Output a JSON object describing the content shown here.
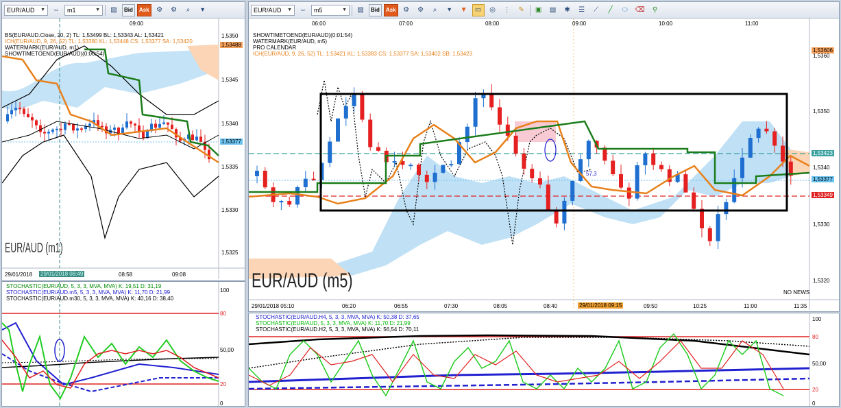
{
  "left_window": {
    "symbol": "EUR/AUD",
    "timeframe": "m1",
    "time_top": "09:00",
    "indicators": [
      {
        "text": "BS(EUR/AUD.Close, 20, 2)  TL: 1,53499  BL: 1,53343  AL: 1,53421",
        "color": "#000000"
      },
      {
        "text": "ICH(EUR/AUD, 9, 26, 52)  TL: 1,53380  KL: 1,53448  CS: 1,53377  SA: 1,53420",
        "color": "#e8801a"
      },
      {
        "text": "WATERMARK(EUR/AUD, m1)",
        "color": "#000000"
      },
      {
        "text": "SHOWTIMETOEND(EUR/AUD)(0:00:54)",
        "color": "#000000"
      }
    ],
    "watermark": "EUR/AUD (m1)",
    "price_axis": [
      "1,5350",
      "1,5345",
      "1,5340",
      "1,5335",
      "1,5330",
      "1,5325"
    ],
    "price_tags": [
      {
        "text": "1,53488",
        "bg": "#f5a05a"
      },
      {
        "text": "1,53377",
        "bg": "#6cc3f0"
      }
    ],
    "time_axis": [
      "29/01/2018",
      "08:58",
      "09:08"
    ],
    "time_badge": "29/01/2018 08:49",
    "stoch_legend": [
      {
        "text": "STOCHASTIC(EUR/AUD, 5, 3, 3, MVA, MVA)  K: 19,51  D: 31,19",
        "color": "#008800"
      },
      {
        "text": "STOCHASTIC(EUR/AUD.m5, 5, 3, 3, MVA, MVA)  K: 11,70  D: 21,99",
        "color": "#2020d0"
      },
      {
        "text": "STOCHASTIC(EUR/AUD.m30, 5, 3, 3, MVA, MVA)  K: 40,16  D: 38,40",
        "color": "#000000"
      }
    ],
    "stoch_axis": [
      "100",
      "80",
      "50,00",
      "20",
      "0"
    ]
  },
  "right_window": {
    "symbol": "EUR/AUD",
    "timeframe": "m5",
    "time_top": [
      "06:00",
      "07:00",
      "08:00",
      "09:00",
      "10:00",
      "11:00"
    ],
    "indicators": [
      {
        "text": "SHOWTIMETOEND(EUR/AUD)(0:01:54)",
        "color": "#000000"
      },
      {
        "text": "WATERMARK(EUR/AUD, m5)",
        "color": "#000000"
      },
      {
        "text": "PRO CALENDAR",
        "color": "#000000"
      },
      {
        "text": "ICH(EUR/AUD, 9, 26, 52)  TL: 1,53421  KL: 1,53383  CS: 1,53377  SA: 1,53402  SB: 1,53423",
        "color": "#e8801a"
      }
    ],
    "watermark": "EUR/AUD (m5)",
    "no_news": "NO NEWS",
    "countdown": "57,3",
    "price_axis": [
      "1,5360",
      "1,5350",
      "1,5340",
      "1,5330",
      "1,5320"
    ],
    "price_tags": [
      {
        "text": "1,53606",
        "bg": "#f5a05a"
      },
      {
        "text": "1,53423",
        "bg": "#3aa0a0"
      },
      {
        "text": "1,53377",
        "bg": "#6cc3f0"
      },
      {
        "text": "1,53349",
        "bg": "#e02020"
      }
    ],
    "time_axis": [
      "29/01/2018 05:10",
      "06:20",
      "06:55",
      "07:30",
      "08:05",
      "08:40",
      "09:50",
      "10:25",
      "11:00",
      "11:35"
    ],
    "time_badge": "29/01/2018 09:15",
    "stoch_legend": [
      {
        "text": "STOCHASTIC(EUR/AUD.H4, 5, 3, 3, MVA, MVA)  K: 50,38  D: 37,65",
        "color": "#2020d0"
      },
      {
        "text": "STOCHASTIC(EUR/AUD, 5, 3, 3, MVA, MVA)  K: 11,70  D: 21,99",
        "color": "#00bb00"
      },
      {
        "text": "STOCHASTIC(EUR/AUD.H2, 5, 3, 3, MVA, MVA)  K: 56,54  D: 70,11",
        "color": "#000000"
      }
    ],
    "stoch_axis": [
      "100",
      "80",
      "50,00",
      "20",
      "0"
    ]
  },
  "toolbar": {
    "bid_label": "Bid",
    "ask_label": "Ask"
  },
  "colors": {
    "bull": "#1e6fd0",
    "bear": "#e52020",
    "tenkan": "#e8801a",
    "kijun": "#1a7d1a",
    "cloud": "#bfe0f5"
  }
}
